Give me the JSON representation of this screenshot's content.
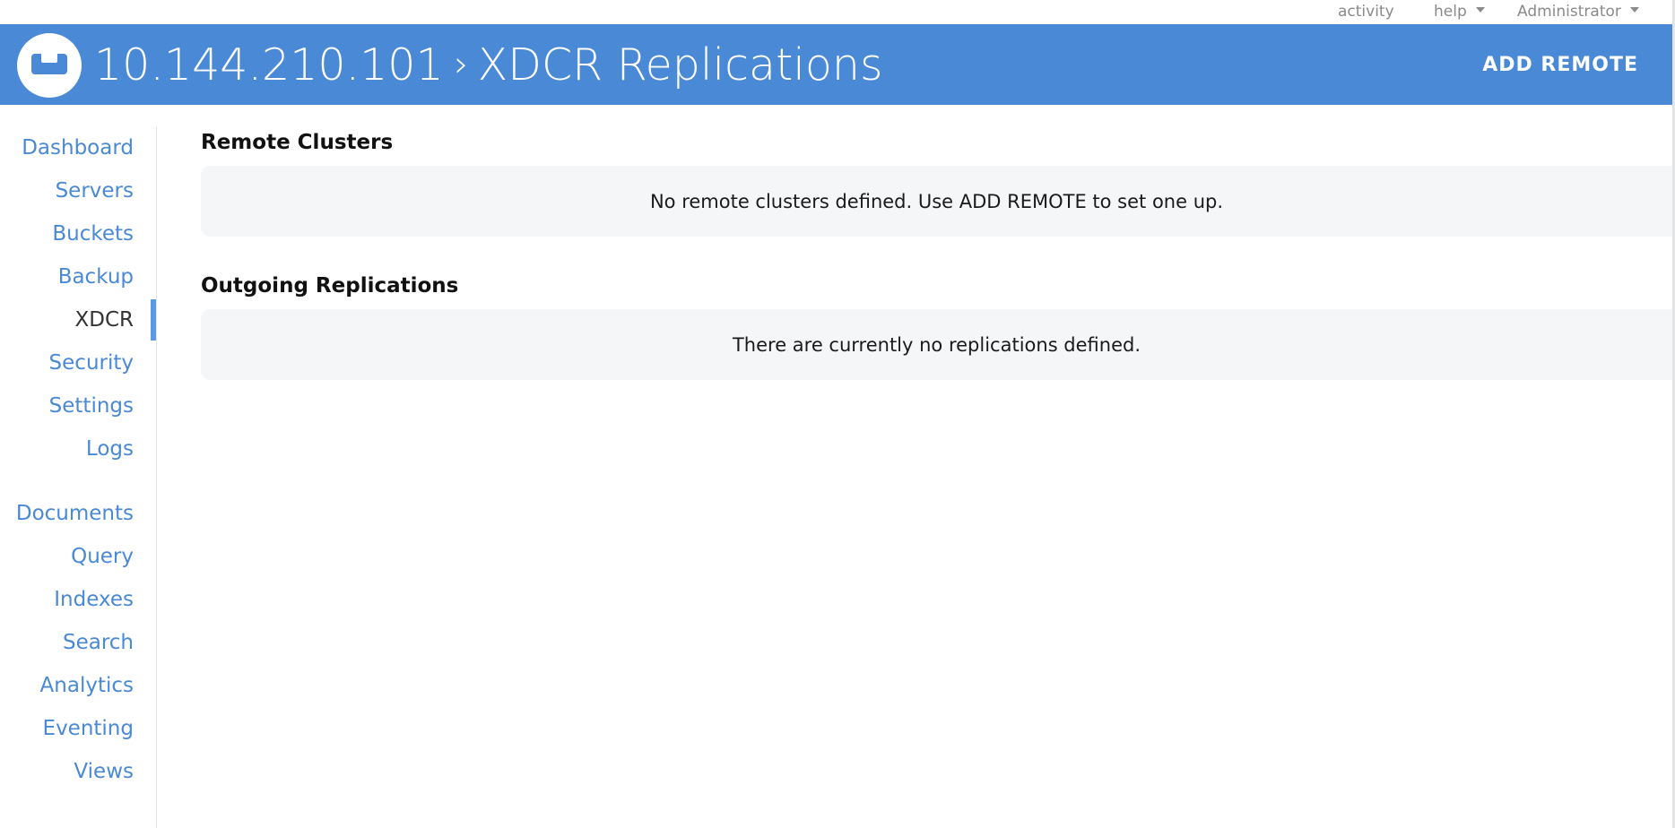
{
  "utilbar": {
    "activity_label": "activity",
    "help_label": "help",
    "user_label": "Administrator"
  },
  "header": {
    "logo": "couchbase-logo",
    "host": "10.144.210.101",
    "separator": "›",
    "page_title": "XDCR Replications",
    "add_remote_label": "ADD REMOTE",
    "bg_color": "#4a89d6"
  },
  "sidebar": {
    "active": "XDCR",
    "groups": [
      [
        "Dashboard",
        "Servers",
        "Buckets",
        "Backup",
        "XDCR",
        "Security",
        "Settings",
        "Logs"
      ],
      [
        "Documents",
        "Query",
        "Indexes",
        "Search",
        "Analytics",
        "Eventing",
        "Views"
      ]
    ],
    "items": {
      "dashboard": "Dashboard",
      "servers": "Servers",
      "buckets": "Buckets",
      "backup": "Backup",
      "xdcr": "XDCR",
      "security": "Security",
      "settings": "Settings",
      "logs": "Logs",
      "documents": "Documents",
      "query": "Query",
      "indexes": "Indexes",
      "search": "Search",
      "analytics": "Analytics",
      "eventing": "Eventing",
      "views": "Views"
    }
  },
  "main": {
    "remote_clusters": {
      "title": "Remote Clusters",
      "empty_message": "No remote clusters defined. Use ADD REMOTE to set one up."
    },
    "outgoing_replications": {
      "title": "Outgoing Replications",
      "empty_message": "There are currently no replications defined."
    }
  }
}
